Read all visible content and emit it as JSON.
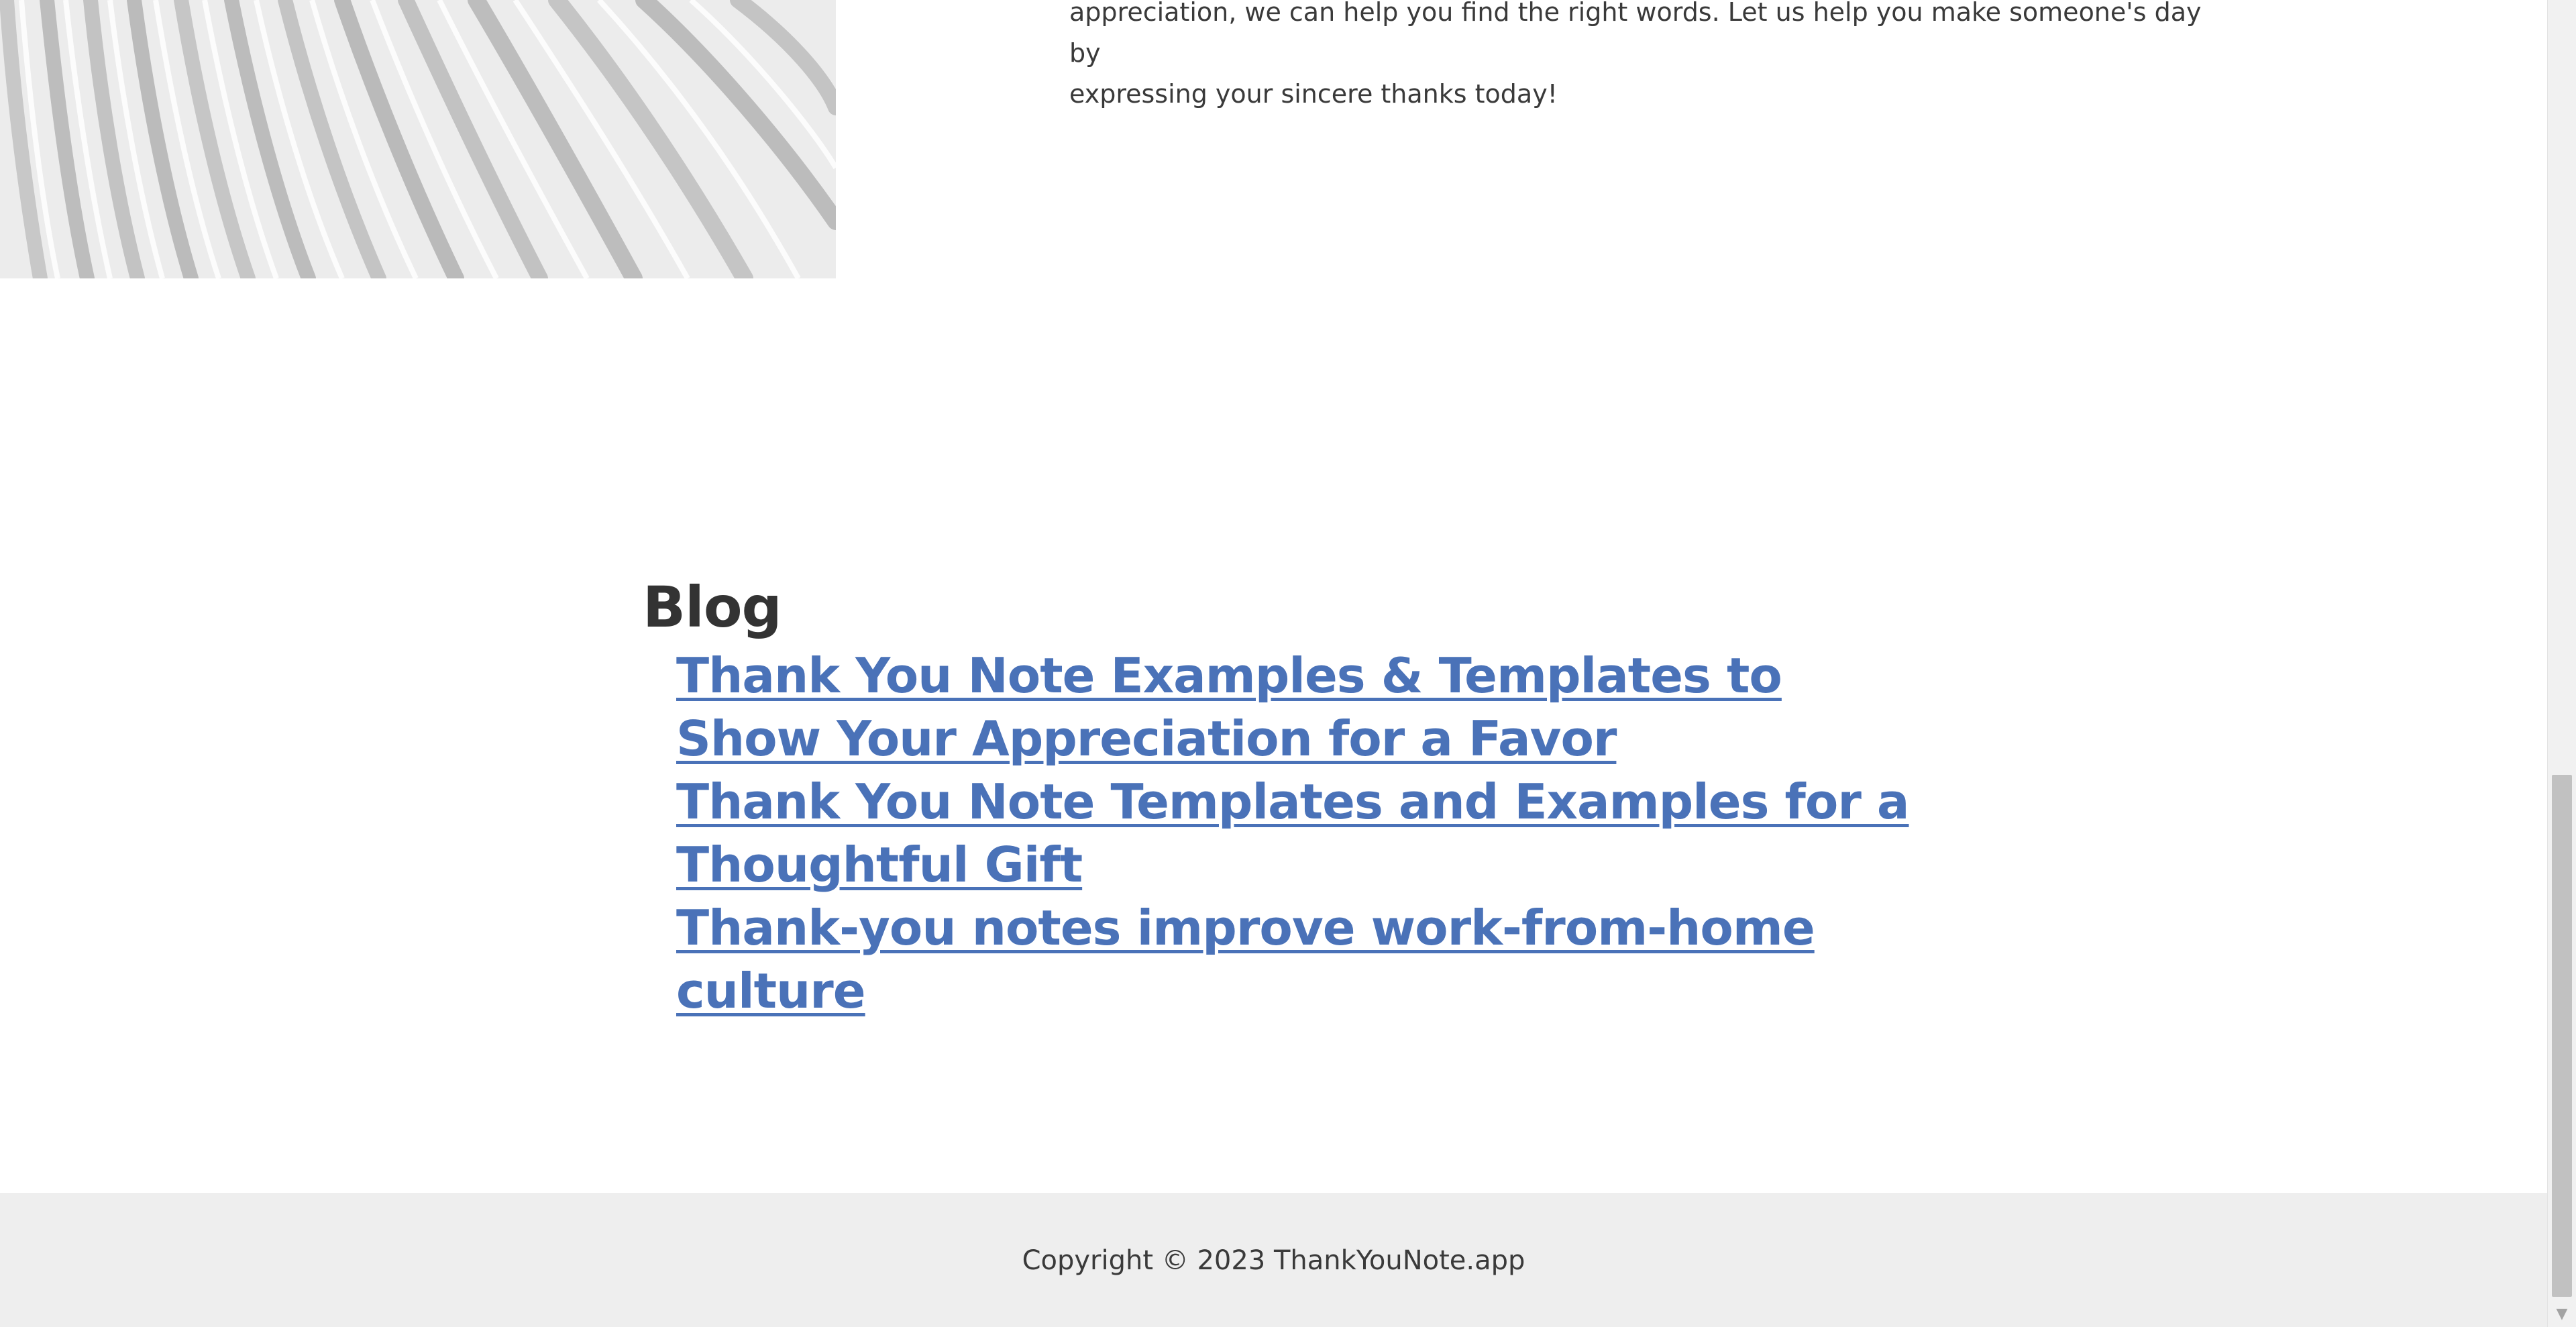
{
  "about": {
    "text_line1": "appreciation, we can help you find the right words. Let us help you make someone's day by",
    "text_line2": "expressing your sincere thanks today!"
  },
  "blog": {
    "title": "Blog",
    "posts": [
      {
        "title": "Thank You Note Examples & Templates to Show Your Appreciation for a Favor"
      },
      {
        "title": "Thank You Note Templates and Examples for a Thoughtful Gift"
      },
      {
        "title": "Thank-you notes improve work-from-home culture"
      }
    ]
  },
  "footer": {
    "copyright": "Copyright © 2023 ThankYouNote.app"
  },
  "colors": {
    "link": "#4a72b8",
    "text": "#333333",
    "footer_bg": "#eeeeee"
  },
  "icons": {
    "scroll_down": "chevron-down-icon"
  }
}
